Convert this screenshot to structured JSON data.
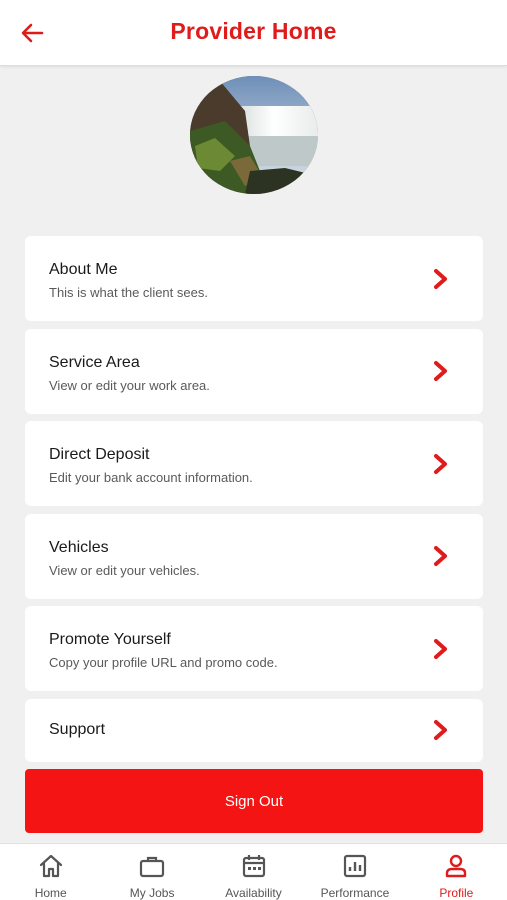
{
  "header": {
    "title": "Provider Home",
    "back_icon": "arrow-left-icon",
    "accent_color": "#e01b1b"
  },
  "profile": {
    "avatar": "waterfall-photo"
  },
  "menu": [
    {
      "title": "About Me",
      "subtitle": "This is what the client sees."
    },
    {
      "title": "Service Area",
      "subtitle": "View or edit your work area."
    },
    {
      "title": "Direct Deposit",
      "subtitle": "Edit your bank account information."
    },
    {
      "title": "Vehicles",
      "subtitle": "View or edit your vehicles."
    },
    {
      "title": "Promote Yourself",
      "subtitle": "Copy your profile URL and promo code."
    },
    {
      "title": "Support"
    }
  ],
  "signout": {
    "label": "Sign Out",
    "color": "#f41414"
  },
  "tabs": [
    {
      "label": "Home",
      "icon": "home-icon"
    },
    {
      "label": "My Jobs",
      "icon": "briefcase-icon"
    },
    {
      "label": "Availability",
      "icon": "calendar-icon"
    },
    {
      "label": "Performance",
      "icon": "bar-chart-icon"
    },
    {
      "label": "Profile",
      "icon": "person-icon",
      "active": true
    }
  ]
}
